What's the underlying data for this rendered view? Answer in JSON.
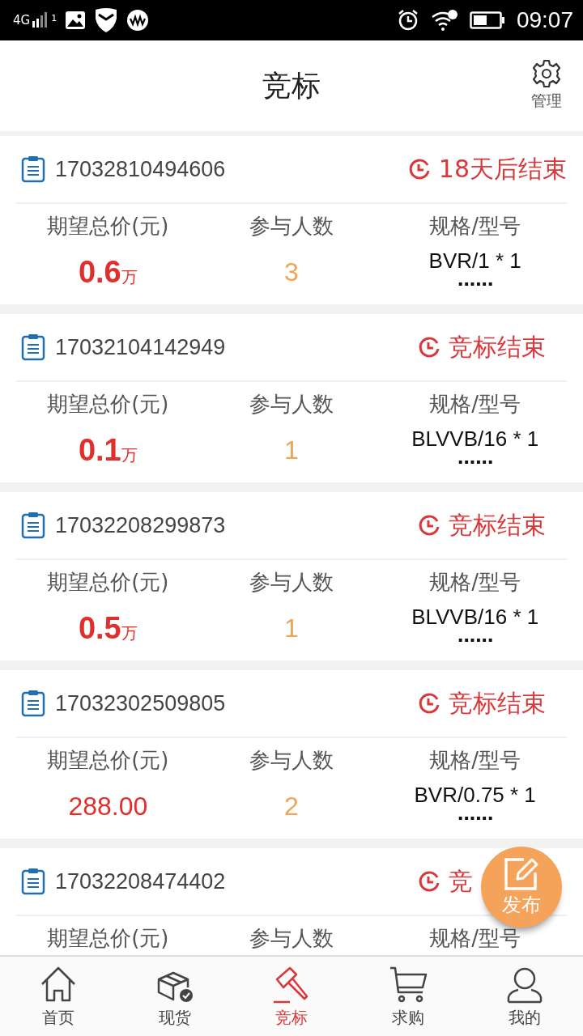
{
  "status_bar": {
    "network": "4G",
    "sim": "1",
    "time": "09:07"
  },
  "header": {
    "title": "竞标",
    "action": "管理"
  },
  "bids": [
    {
      "id": "17032810494606",
      "status": "18天后结束",
      "labels": [
        "期望总价(元)",
        "参与人数",
        "规格/型号"
      ],
      "price": {
        "kind": "wan",
        "value": "0.6",
        "unit": "万"
      },
      "participants": "3",
      "spec": "BVR/1 * 1",
      "more": "......"
    },
    {
      "id": "17032104142949",
      "status": "竞标结束",
      "labels": [
        "期望总价(元)",
        "参与人数",
        "规格/型号"
      ],
      "price": {
        "kind": "wan",
        "value": "0.1",
        "unit": "万"
      },
      "participants": "1",
      "spec": "BLVVB/16 * 1",
      "more": "......"
    },
    {
      "id": "17032208299873",
      "status": "竞标结束",
      "labels": [
        "期望总价(元)",
        "参与人数",
        "规格/型号"
      ],
      "price": {
        "kind": "wan",
        "value": "0.5",
        "unit": "万"
      },
      "participants": "1",
      "spec": "BLVVB/16 * 1",
      "more": "......"
    },
    {
      "id": "17032302509805",
      "status": "竞标结束",
      "labels": [
        "期望总价(元)",
        "参与人数",
        "规格/型号"
      ],
      "price": {
        "kind": "plain",
        "value": "288.00"
      },
      "participants": "2",
      "spec": "BVR/0.75 * 1",
      "more": "......"
    },
    {
      "id": "17032208474402",
      "status": "竞",
      "labels": [
        "期望总价(元)",
        "参与人数",
        "规格/型号"
      ]
    }
  ],
  "fab": {
    "label": "发布"
  },
  "tabs": [
    {
      "label": "首页",
      "kind": "home",
      "selected": false
    },
    {
      "label": "现货",
      "kind": "box",
      "selected": false
    },
    {
      "label": "竞标",
      "kind": "gavel",
      "selected": true
    },
    {
      "label": "求购",
      "kind": "cart",
      "selected": false
    },
    {
      "label": "我的",
      "kind": "user",
      "selected": false
    }
  ]
}
